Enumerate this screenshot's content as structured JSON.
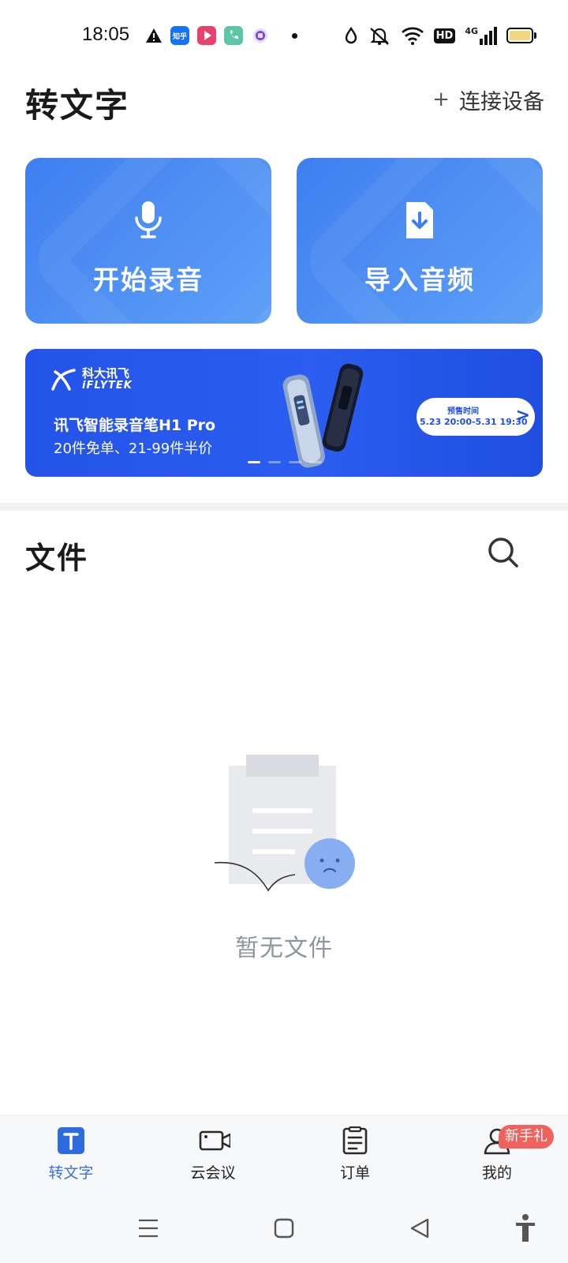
{
  "status_bar": {
    "time": "18:05",
    "left_icons": [
      "warning-icon",
      "zhihu-app-icon",
      "video-app-icon",
      "phone-app-icon",
      "purple-app-icon",
      "dot-icon"
    ],
    "zhihu_label": "知乎",
    "right_icons": [
      "drop-icon",
      "mute-icon",
      "wifi-icon",
      "hd-icon",
      "signal-4g-icon",
      "battery-icon"
    ],
    "hd_label": "HD",
    "network_label": "4G"
  },
  "header": {
    "title": "转文字",
    "connect_plus": "+",
    "connect_label": "连接设备"
  },
  "actions": [
    {
      "label": "开始录音",
      "icon": "microphone-icon"
    },
    {
      "label": "导入音频",
      "icon": "import-file-icon"
    }
  ],
  "banner": {
    "brand_cn": "科大讯飞",
    "brand_en": "iFLYTEK",
    "title": "讯飞智能录音笔H1 Pro",
    "subtitle": "20件免单、21-99件半价",
    "presale_label": "预售时间",
    "presale_time": "5.23 20:00-5.31 19:30",
    "arrow": ">",
    "active_slide_index": 0,
    "slide_count": 4
  },
  "files": {
    "title": "文件",
    "empty_text": "暂无文件"
  },
  "bottom_nav": {
    "items": [
      {
        "label": "转文字",
        "icon": "transcribe-icon",
        "active": true
      },
      {
        "label": "云会议",
        "icon": "video-camera-icon",
        "active": false
      },
      {
        "label": "订单",
        "icon": "order-icon",
        "active": false
      },
      {
        "label": "我的",
        "icon": "profile-icon",
        "active": false,
        "badge": "新手礼"
      }
    ]
  },
  "system_nav": [
    "menu-icon",
    "home-icon",
    "back-icon",
    "accessibility-icon"
  ],
  "colors": {
    "accent": "#3a72d8",
    "card_blue": "#4a8cf2",
    "banner_blue": "#2453e8",
    "badge_red": "#f0625e",
    "empty_text": "#8f959e"
  }
}
